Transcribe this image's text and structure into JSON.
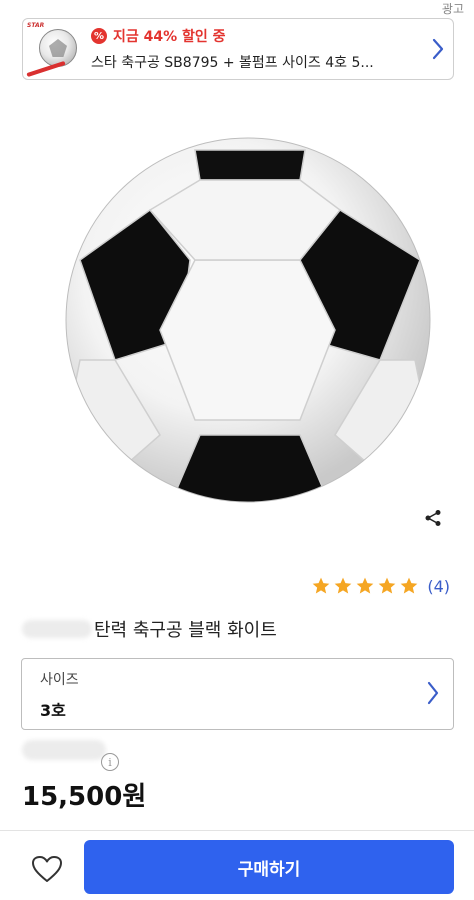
{
  "ad": {
    "tag": "광고",
    "brand": "STAR",
    "discount_text": "지금 44% 할인 중",
    "discount_icon": "%",
    "title": "스타 축구공 SB8795 + 볼펌프 사이즈 4호 5..."
  },
  "product": {
    "name": "탄력 축구공 블랙 화이트",
    "rating_stars": 5,
    "review_count": "(4)",
    "size": {
      "label": "사이즈",
      "value": "3호"
    },
    "info_icon": "i",
    "price": "15,500원"
  },
  "footer": {
    "buy_label": "구매하기"
  },
  "colors": {
    "accent": "#2f62ee",
    "link": "#3a5dc9",
    "star": "#f5a623",
    "sale": "#e3342f"
  },
  "icons": [
    "percent-badge-icon",
    "chevron-right-icon",
    "share-icon",
    "star-icon",
    "info-icon",
    "heart-icon"
  ]
}
